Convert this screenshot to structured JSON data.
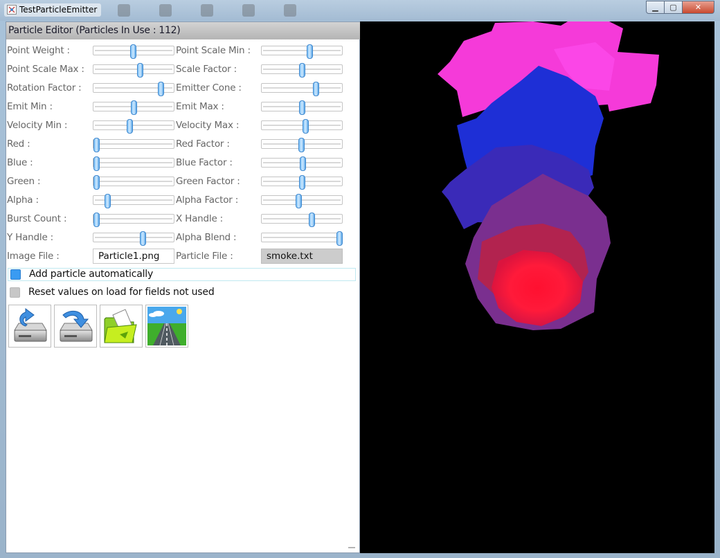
{
  "window": {
    "title": "TestParticleEmitter",
    "minimize_icon": "minimize-icon",
    "maximize_icon": "maximize-icon",
    "close_icon": "close-icon"
  },
  "editor": {
    "header": "Particle Editor (Particles In Use : 112)",
    "sliders_left": [
      {
        "label": "Point Weight :",
        "value": 0.49
      },
      {
        "label": "Point Scale Max :",
        "value": 0.58
      },
      {
        "label": "Rotation Factor :",
        "value": 0.83
      },
      {
        "label": "Emit Min :",
        "value": 0.5
      },
      {
        "label": "Velocity Min :",
        "value": 0.45
      },
      {
        "label": "Red :",
        "value": 0.04
      },
      {
        "label": "Blue :",
        "value": 0.04
      },
      {
        "label": "Green :",
        "value": 0.04
      },
      {
        "label": "Alpha :",
        "value": 0.18
      },
      {
        "label": "Burst Count :",
        "value": 0.04
      },
      {
        "label": "Y Handle :",
        "value": 0.61
      }
    ],
    "sliders_right": [
      {
        "label": "Point Scale Min :",
        "value": 0.59
      },
      {
        "label": "Scale Factor :",
        "value": 0.5
      },
      {
        "label": "Emitter Cone :",
        "value": 0.67
      },
      {
        "label": "Emit Max :",
        "value": 0.5
      },
      {
        "label": "Velocity Max :",
        "value": 0.54
      },
      {
        "label": "Red Factor :",
        "value": 0.49
      },
      {
        "label": "Blue Factor :",
        "value": 0.51
      },
      {
        "label": "Green Factor :",
        "value": 0.5
      },
      {
        "label": "Alpha Factor :",
        "value": 0.46
      },
      {
        "label": "X Handle :",
        "value": 0.62
      },
      {
        "label": "Alpha Blend :",
        "value": 0.96
      }
    ],
    "image_file": {
      "label": "Image File :",
      "value": "Particle1.png"
    },
    "particle_file": {
      "label": "Particle File :",
      "value": "smoke.txt"
    },
    "checks": [
      {
        "label": "Add particle automatically",
        "checked": true
      },
      {
        "label": "Reset values on load for fields not used",
        "checked": false
      }
    ],
    "toolbar": [
      {
        "icon": "load-drive-icon"
      },
      {
        "icon": "save-drive-icon"
      },
      {
        "icon": "open-folder-icon"
      },
      {
        "icon": "road-background-icon"
      }
    ]
  },
  "colors": {
    "pink": "#f53ad9",
    "blue": "#1e2fd6",
    "purple": "#7a2f8f",
    "red": "#ff1030",
    "checkbox_on": "#3a9bf2",
    "checkbox_off": "#c7c7c7"
  }
}
